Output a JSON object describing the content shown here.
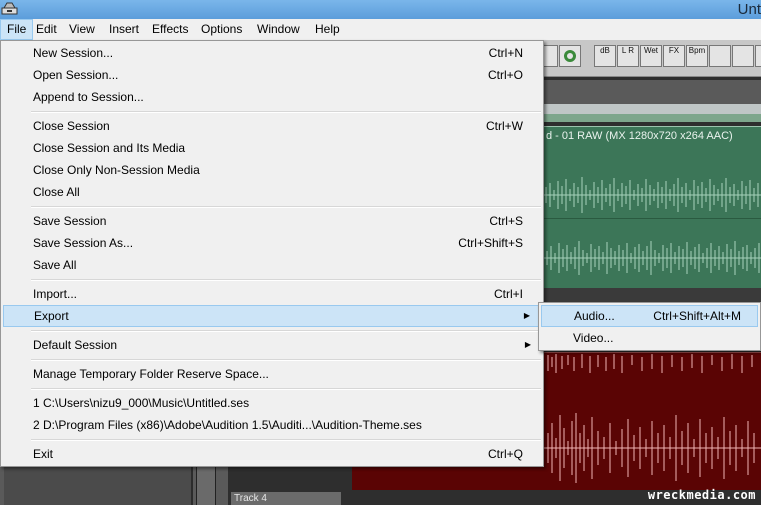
{
  "window": {
    "title": "Unt"
  },
  "menubar": [
    "File",
    "Edit",
    "View",
    "Insert",
    "Effects",
    "Options",
    "Window",
    "Help"
  ],
  "toolbar": {
    "buttons": [
      {
        "icon": "timer-icon",
        "label": ""
      },
      {
        "icon": "hand-icon",
        "label": ""
      },
      {
        "icon": "db-envelope-icon",
        "label": "dB"
      },
      {
        "icon": "pan-envelope-icon",
        "label": "L R"
      },
      {
        "icon": "wet-envelope-icon",
        "label": "Wet"
      },
      {
        "icon": "fx-envelope-icon",
        "label": "FX"
      },
      {
        "icon": "bpm-icon",
        "label": "Bpm"
      },
      {
        "icon": "snap-icon",
        "label": ""
      },
      {
        "icon": "split-icon",
        "label": ""
      },
      {
        "icon": "lock-icon",
        "label": ""
      }
    ]
  },
  "clip": {
    "label": "d - 01 RAW (MX 1280x720 x264 AAC)"
  },
  "track4": {
    "label": "Track 4"
  },
  "watermark": "wreckmedia.com",
  "file_menu": {
    "groups": [
      [
        {
          "label": "New Session...",
          "shortcut": "Ctrl+N"
        },
        {
          "label": "Open Session...",
          "shortcut": "Ctrl+O"
        },
        {
          "label": "Append to Session...",
          "shortcut": ""
        }
      ],
      [
        {
          "label": "Close Session",
          "shortcut": "Ctrl+W"
        },
        {
          "label": "Close Session and Its Media",
          "shortcut": ""
        },
        {
          "label": "Close Only Non-Session Media",
          "shortcut": ""
        },
        {
          "label": "Close All",
          "shortcut": ""
        }
      ],
      [
        {
          "label": "Save Session",
          "shortcut": "Ctrl+S"
        },
        {
          "label": "Save Session As...",
          "shortcut": "Ctrl+Shift+S"
        },
        {
          "label": "Save All",
          "shortcut": ""
        }
      ],
      [
        {
          "label": "Import...",
          "shortcut": "Ctrl+I"
        },
        {
          "label": "Export",
          "shortcut": "",
          "submenu": true,
          "highlighted": true
        }
      ],
      [
        {
          "label": "Default Session",
          "shortcut": "",
          "submenu": true
        }
      ],
      [
        {
          "label": "Manage Temporary Folder Reserve Space...",
          "shortcut": ""
        }
      ],
      [
        {
          "label": "1 C:\\Users\\nizu9_000\\Music\\Untitled.ses",
          "shortcut": ""
        },
        {
          "label": "2 D:\\Program Files (x86)\\Adobe\\Audition 1.5\\Auditi...\\Audition-Theme.ses",
          "shortcut": ""
        }
      ],
      [
        {
          "label": "Exit",
          "shortcut": "Ctrl+Q"
        }
      ]
    ]
  },
  "export_submenu": [
    {
      "label": "Audio...",
      "shortcut": "Ctrl+Shift+Alt+M",
      "highlighted": true
    },
    {
      "label": "Video...",
      "shortcut": ""
    }
  ]
}
